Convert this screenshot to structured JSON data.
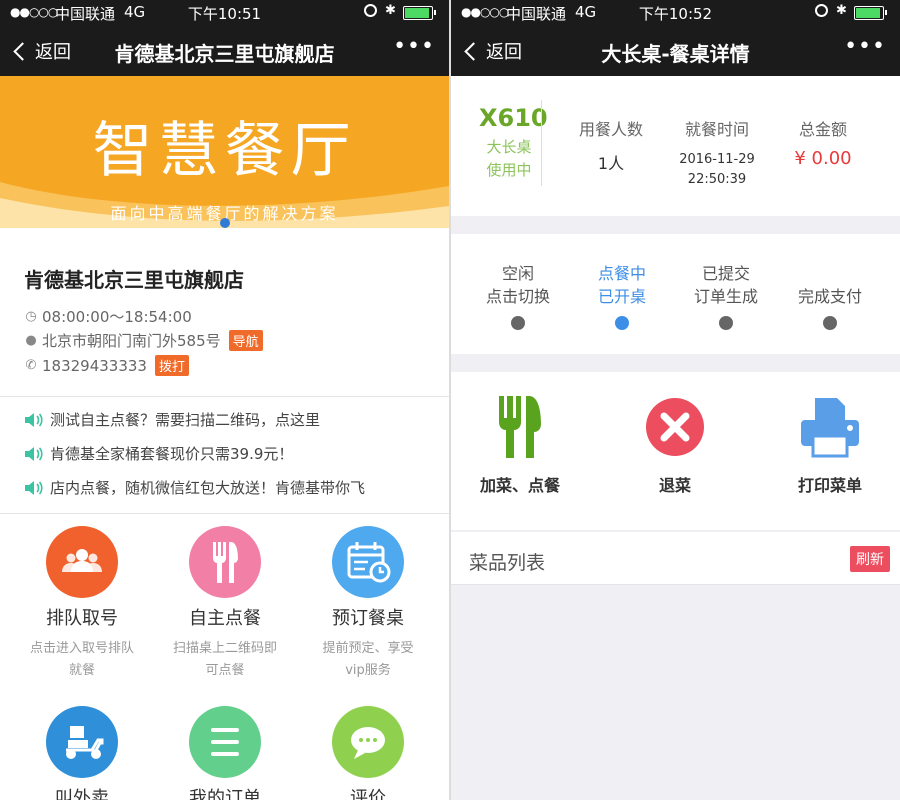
{
  "colors": {
    "nav_bg": "#1b1b1b",
    "banner": "#f5a623",
    "tag": "#f06a2a",
    "active_blue": "#3d8ee6",
    "table_green": "#6aa628",
    "amount_red": "#e83b3b",
    "refresh_red": "#ec4e5f",
    "battery_green": "#4cd964"
  },
  "left": {
    "status": {
      "signal": "●●○○○",
      "carrier": "中国联通",
      "network": "4G",
      "time": "下午10:51"
    },
    "nav": {
      "back": "返回",
      "title": "肯德基北京三里屯旗舰店",
      "more": "•••"
    },
    "banner": {
      "title": "智慧餐厅",
      "subtitle": "面向中高端餐厅的解决方案"
    },
    "shop": {
      "name": "肯德基北京三里屯旗舰店",
      "hours": "08:00:00～18:54:00",
      "address": "北京市朝阳门南门外585号",
      "address_tag": "导航",
      "phone": "18329433333",
      "phone_tag": "拨打"
    },
    "notices": [
      "测试自主点餐？需要扫描二维码，点这里",
      "肯德基全家桶套餐现价只需39.9元！",
      "店内点餐，随机微信红包大放送！肯德基带你飞"
    ],
    "grid": [
      {
        "label": "排队取号",
        "desc": "点击进入取号排队就餐",
        "color": "#f0612d",
        "icon": "people-icon"
      },
      {
        "label": "自主点餐",
        "desc": "扫描桌上二维码即可点餐",
        "color": "#f27fa5",
        "icon": "fork-knife-icon"
      },
      {
        "label": "预订餐桌",
        "desc": "提前预定、享受vip服务",
        "color": "#4fa9ee",
        "icon": "calendar-icon"
      },
      {
        "label": "叫外卖",
        "desc": "",
        "color": "#2f8fd8",
        "icon": "scooter-icon"
      },
      {
        "label": "我的订单",
        "desc": "",
        "color": "#62cf8c",
        "icon": "list-icon"
      },
      {
        "label": "评价",
        "desc": "",
        "color": "#8fd14f",
        "icon": "chat-icon"
      }
    ]
  },
  "right": {
    "status": {
      "signal": "●●○○○",
      "carrier": "中国联通",
      "network": "4G",
      "time": "下午10:52"
    },
    "nav": {
      "back": "返回",
      "title": "大长桌-餐桌详情",
      "more": "•••"
    },
    "table": {
      "code": "X610",
      "name": "大长桌",
      "state": "使用中"
    },
    "stats": {
      "diners_label": "用餐人数",
      "diners_value": "1人",
      "time_label": "就餐时间",
      "time_date": "2016-11-29",
      "time_clock": "22:50:39",
      "total_label": "总金额",
      "total_value": "¥ 0.00"
    },
    "steps": [
      {
        "line1": "空闲",
        "line2": "点击切换",
        "active": false
      },
      {
        "line1": "点餐中",
        "line2": "已开桌",
        "active": true
      },
      {
        "line1": "已提交",
        "line2": "订单生成",
        "active": false
      },
      {
        "line1": "完成支付",
        "line2": "",
        "active": false
      }
    ],
    "actions": [
      {
        "label": "加菜、点餐",
        "icon": "fork-knife-icon"
      },
      {
        "label": "退菜",
        "icon": "cancel-icon"
      },
      {
        "label": "打印菜单",
        "icon": "printer-icon"
      }
    ],
    "menu": {
      "title": "菜品列表",
      "refresh": "刷新"
    }
  }
}
